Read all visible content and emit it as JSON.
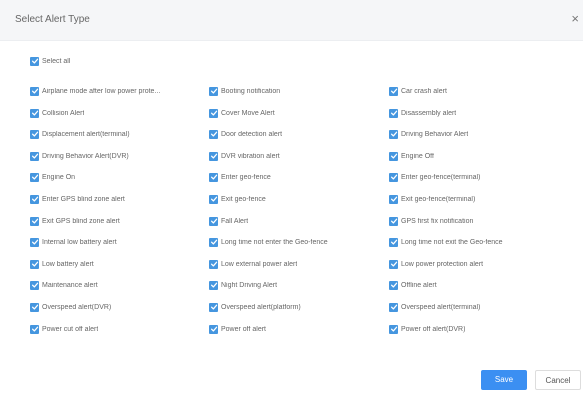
{
  "dialog": {
    "title": "Select Alert Type",
    "close_glyph": "×",
    "select_all": "Select all",
    "checked": true,
    "options": [
      "Airplane mode after low power prote...",
      "Booting notification",
      "Car crash alert",
      "Collision Alert",
      "Cover Move Alert",
      "Disassembly alert",
      "Displacement alert(terminal)",
      "Door detection alert",
      "Driving Behavior Alert",
      "Driving Behavior Alert(DVR)",
      "DVR vibration alert",
      "Engine Off",
      "Engine On",
      "Enter geo-fence",
      "Enter geo-fence(terminal)",
      "Enter GPS blind zone alert",
      "Exit geo-fence",
      "Exit geo-fence(terminal)",
      "Exit GPS blind zone alert",
      "Fall Alert",
      "GPS first fix notification",
      "Internal low battery alert",
      "Long time not enter the Geo-fence",
      "Long time not exit the Geo-fence",
      "Low battery alert",
      "Low external power alert",
      "Low power protection alert",
      "Maintenance alert",
      "Night Driving Alert",
      "Offline alert",
      "Overspeed alert(DVR)",
      "Overspeed alert(platform)",
      "Overspeed alert(terminal)",
      "Power cut off alert",
      "Power off alert",
      "Power off alert(DVR)"
    ]
  },
  "footer": {
    "save_label": "Save",
    "cancel_label": "Cancel"
  },
  "colors": {
    "checkbox": "#4596df",
    "save_button": "#3b8ff2"
  },
  "icons": {
    "close": "close-icon",
    "checkbox": "checkmark-icon"
  }
}
